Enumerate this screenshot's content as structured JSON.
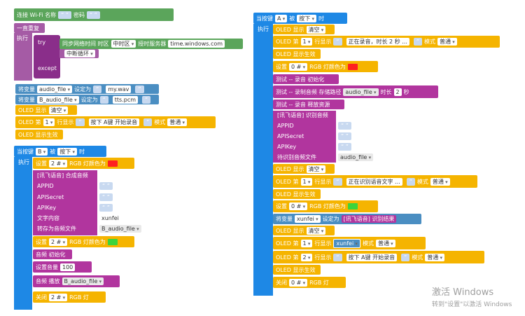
{
  "left_top": {
    "wifi": {
      "label": "连接 Wi-Fi 名称",
      "pwd_label": "密码"
    },
    "loop": {
      "label": "一直重复",
      "exec": "执行"
    },
    "try": {
      "try": "try",
      "except": "except",
      "sync": "同步网络时间 时区",
      "tz": "中时区",
      "server_label": "授时服务器",
      "server": "time.windows.com",
      "break": "中断循环"
    },
    "var1": {
      "label": "将变量",
      "name": "audio_file",
      "set": "设定为",
      "value": "my.wav"
    },
    "var2": {
      "label": "将变量",
      "name": "B_audio_file",
      "set": "设定为",
      "value": "tts.pcm"
    },
    "oled_clear": {
      "label": "OLED 显示",
      "mode": "清空"
    },
    "oled_line": {
      "label": "OLED 第",
      "num": "1",
      "mid": "行显示",
      "text": "按下 A键 开始录音",
      "mode_label": "模式",
      "mode": "普通"
    },
    "oled_show": {
      "label": "OLED 显示生效"
    }
  },
  "left_b": {
    "hat": {
      "label": "当按键",
      "key": "B",
      "is": "被",
      "action": "按下",
      "time": "时"
    },
    "exec": "执行",
    "rgb1": {
      "set": "设置",
      "idx": "2 #",
      "label": "RGB 灯颜色为",
      "color": "#ff2020"
    },
    "tts": {
      "title": "[讯飞语音] 合成音频",
      "appid": "APPID",
      "apisecret": "APISecret",
      "apikey": "APIKey",
      "text_label": "文字内容",
      "text": "xunfei",
      "save_label": "转存为音频文件",
      "file": "B_audio_file"
    },
    "rgb2": {
      "set": "设置",
      "idx": "2 #",
      "label": "RGB 灯颜色为",
      "color": "#3cd43c"
    },
    "audio_init": "音频 初始化",
    "volume": {
      "label": "设置音量",
      "value": "100"
    },
    "play": {
      "label": "音频 播放",
      "file": "B_audio_file"
    },
    "off": {
      "label": "关闭",
      "idx": "2 #",
      "rgb": "RGB 灯"
    }
  },
  "right_a": {
    "hat": {
      "label": "当按键",
      "key": "A",
      "is": "被",
      "action": "按下",
      "time": "时"
    },
    "exec": "执行",
    "clear1": {
      "label": "OLED 显示",
      "mode": "清空"
    },
    "line1": {
      "label": "OLED 第",
      "num": "1",
      "mid": "行显示",
      "text": "正在录音，时长 2 秒 ...",
      "mode_label": "模式",
      "mode": "普通"
    },
    "show1": "OLED 显示生效",
    "rgb1": {
      "set": "设置",
      "idx": "0 #",
      "label": "RGB 灯颜色为",
      "color": "#ff2020"
    },
    "rec_init": "测试 -- 录音 初始化",
    "rec": {
      "label": "测试 -- 录制音频 存储路径",
      "file": "audio_file",
      "dur_label": "时长",
      "dur": "2",
      "sec": "秒"
    },
    "rec_free": "测试 -- 录音 释放资源",
    "asr": {
      "title": "[讯飞语音] 识别音频",
      "appid": "APPID",
      "apisecret": "APISecret",
      "apikey": "APIKey",
      "file_label": "待识别音频文件",
      "file": "audio_file"
    },
    "clear2": {
      "label": "OLED 显示",
      "mode": "清空"
    },
    "line2": {
      "label": "OLED 第",
      "num": "1",
      "mid": "行显示",
      "text": "正在识别语音文字 ...",
      "mode_label": "模式",
      "mode": "普通"
    },
    "show2": "OLED 显示生效",
    "rgb2": {
      "set": "设置",
      "idx": "0 #",
      "label": "RGB 灯颜色为",
      "color": "#3cd43c"
    },
    "var": {
      "label": "将变量",
      "name": "xunfei",
      "set": "设定为",
      "value": "[讯飞语音] 识别结果"
    },
    "clear3": {
      "label": "OLED 显示",
      "mode": "清空"
    },
    "line3": {
      "label": "OLED 第",
      "num": "1",
      "mid": "行显示",
      "var": "xunfei",
      "mode_label": "模式",
      "mode": "普通"
    },
    "line4": {
      "label": "OLED 第",
      "num": "2",
      "mid": "行显示",
      "text": "按下 A键 开始录音",
      "mode_label": "模式",
      "mode": "普通"
    },
    "show3": "OLED 显示生效",
    "off": {
      "label": "关闭",
      "idx": "0 #",
      "rgb": "RGB 灯"
    }
  },
  "watermark": {
    "line1": "激活 Windows",
    "line2": "转到\"设置\"以激活 Windows"
  }
}
